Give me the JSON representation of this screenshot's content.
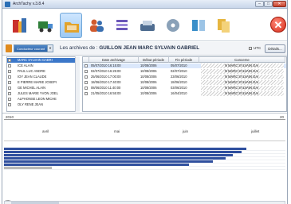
{
  "window": {
    "title": "ArchTachy v.3.8.4",
    "controls": {
      "minimize": "–",
      "maximize": "□",
      "close": "✕"
    },
    "accent": "#3b77c9"
  },
  "toolbar": {
    "buttons": [
      {
        "name": "archive-tool",
        "icon": "archive-icon",
        "color": "#c9302c"
      },
      {
        "name": "truck-tool",
        "icon": "truck-icon",
        "color": "#2f7f3a"
      },
      {
        "name": "folder-tool",
        "icon": "folder-icon",
        "color": "#e2a32b"
      },
      {
        "name": "people-tool",
        "icon": "people-icon",
        "color": "#d05a2e"
      },
      {
        "name": "list-tool",
        "icon": "list-icon",
        "color": "#6b57b7"
      },
      {
        "name": "reader-tool",
        "icon": "card-reader-icon",
        "color": "#4e6c90"
      },
      {
        "name": "cd-tool",
        "icon": "cd-icon",
        "color": "#8aa1b8"
      },
      {
        "name": "export-tool",
        "icon": "export-icon",
        "color": "#3a8fc9"
      },
      {
        "name": "files-tool",
        "icon": "files-icon",
        "color": "#e6b640"
      }
    ],
    "exit_icon": "✕"
  },
  "panel": {
    "combo_value": "Conducteur courant",
    "archives_label": "Les archives de :",
    "driver_name": "GUILLON JEAN MARC SYLVAIN GABRIEL",
    "utc_label": "UTC",
    "detail_button": "Détails..."
  },
  "people": [
    {
      "name": "MARC SYLVAIN GABRI",
      "selected": true
    },
    {
      "name": "ICE ALAIN",
      "selected": false
    },
    {
      "name": "PAUL LUC ANDRE",
      "selected": false
    },
    {
      "name": "IOY JEAN CLAUDE",
      "selected": false
    },
    {
      "name": "E PIERRE MARIE JOSEPI",
      "selected": false
    },
    {
      "name": "GE MICHEL ALAIN",
      "selected": false
    },
    {
      "name": "JULES MARIE YVON JOEL",
      "selected": false
    },
    {
      "name": "ALPHONSE LEON MICHE",
      "selected": false
    },
    {
      "name": "OLY RENE JEAN",
      "selected": false
    }
  ],
  "grid": {
    "headers": [
      "Date archivage",
      "Début période",
      "Fin période",
      "Concerne"
    ],
    "rows": [
      {
        "date": "05/07/2010 16:15:00",
        "debut": "10/08/2006",
        "fin": "05/07/2010",
        "concerne": "N MARC SYLVAIN GAI",
        "selected": true
      },
      {
        "date": "02/07/2010 16:25:00",
        "debut": "10/08/2006",
        "fin": "02/07/2010",
        "concerne": "N MARC SYLVAIN GAI",
        "selected": false
      },
      {
        "date": "25/06/2010 17:00:00",
        "debut": "10/08/2006",
        "fin": "23/06/2010",
        "concerne": "N MARC SYLVAIN GAI",
        "selected": false
      },
      {
        "date": "18/06/2010 17:40:00",
        "debut": "10/08/2006",
        "fin": "18/06/2010",
        "concerne": "N MARC SYLVAIN GAI",
        "selected": false
      },
      {
        "date": "08/06/2010 11:40:00",
        "debut": "10/08/2006",
        "fin": "03/06/2010",
        "concerne": "N MARC SYLVAIN GAI",
        "selected": false
      },
      {
        "date": "21/05/2010 16:55:00",
        "debut": "10/08/2006",
        "fin": "16/04/2010",
        "concerne": "N MARC SYLVAIN GAI",
        "selected": false
      }
    ]
  },
  "timeline": {
    "year_left": "2010",
    "year_right": "20",
    "months": [
      "avril",
      "mai",
      "juin",
      "juillet"
    ],
    "bottom_label": "sec",
    "bar_colors": {
      "blue": "#2f4f9e",
      "gray": "#b8b8b8"
    }
  }
}
